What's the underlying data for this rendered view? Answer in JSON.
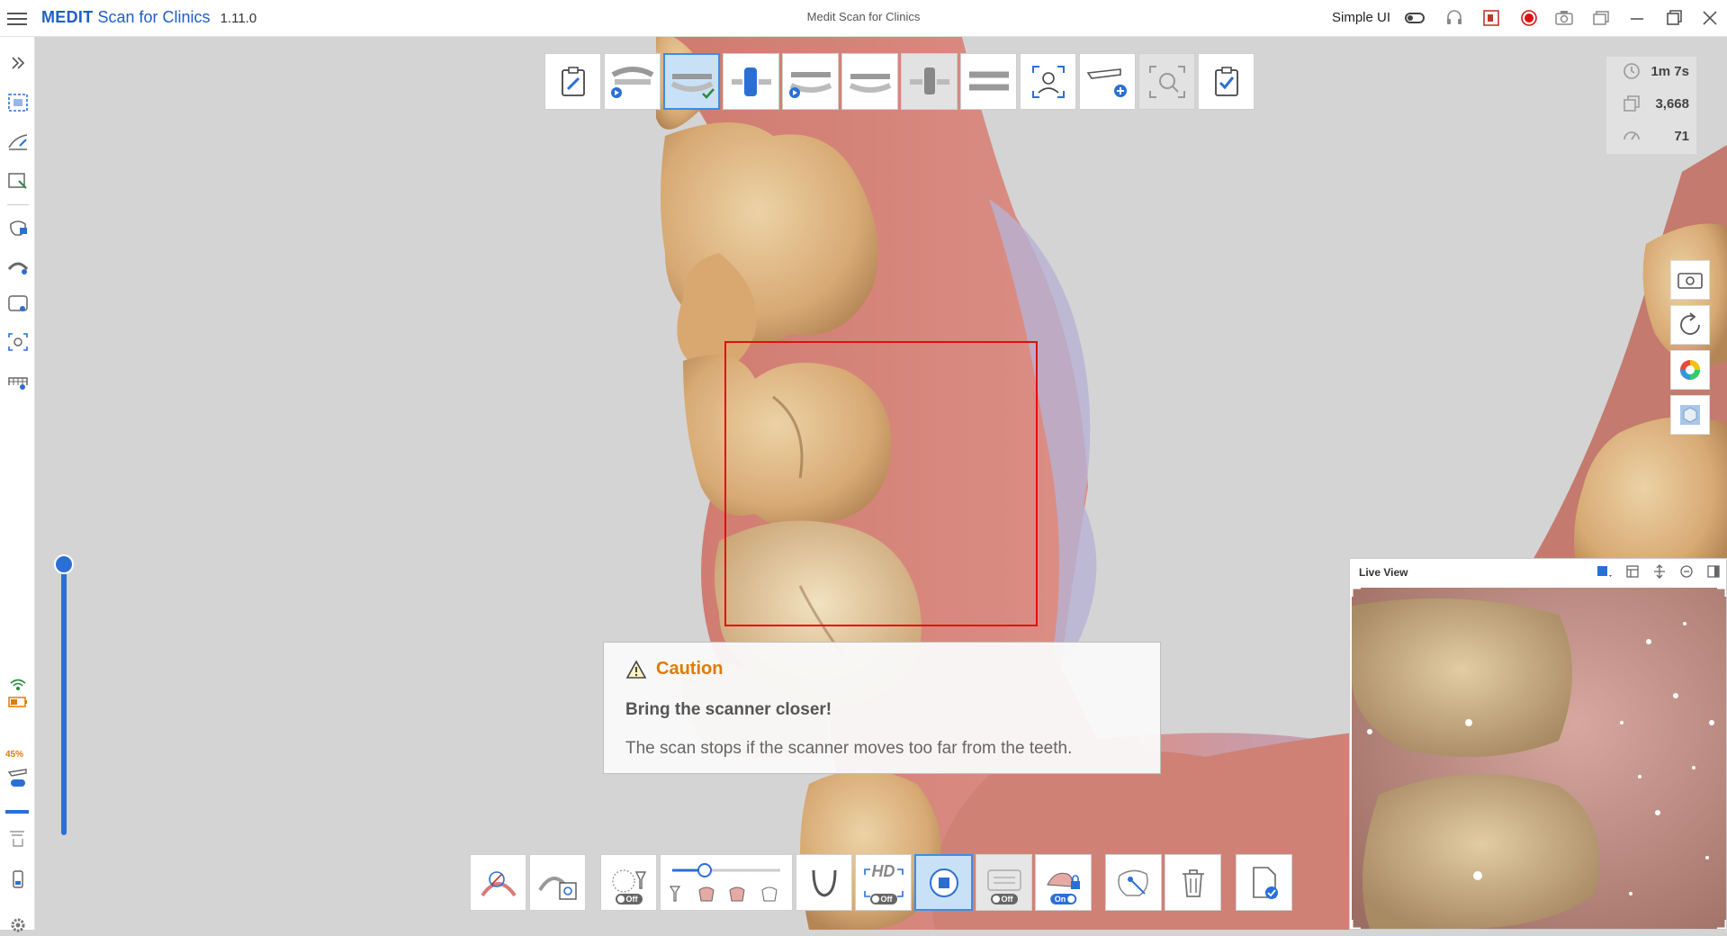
{
  "app": {
    "brand_bold": "MEDIT",
    "brand_rest": "Scan for Clinics",
    "version": "1.11.0",
    "window_title": "Medit Scan for Clinics"
  },
  "titlebar": {
    "simple_ui_label": "Simple UI",
    "simple_ui_enabled": false,
    "icons": [
      "headset-icon",
      "screen-capture-icon",
      "record-icon",
      "camera-icon",
      "window-switch-icon",
      "minimize-icon",
      "maximize-icon",
      "close-icon"
    ]
  },
  "sidebar": {
    "items": [
      "expand-icon",
      "scan-area-icon",
      "edit-scan-icon",
      "smart-select-icon",
      "lock-tooth-icon",
      "arch-icon",
      "tooth-view-icon",
      "screen-capture-icon",
      "tooth-library-icon"
    ],
    "status": {
      "wifi": "connected",
      "battery_percent": "45%",
      "scanner_mode": "active"
    }
  },
  "steps": {
    "items": [
      {
        "name": "form-step",
        "state": "normal"
      },
      {
        "name": "maxilla-step",
        "state": "normal"
      },
      {
        "name": "mandible-step",
        "state": "active"
      },
      {
        "name": "mandible-scanbody-step",
        "state": "normal"
      },
      {
        "name": "occlusion-step",
        "state": "normal"
      },
      {
        "name": "occlusion-2-step",
        "state": "normal"
      },
      {
        "name": "scanbody-step",
        "state": "dim"
      },
      {
        "name": "bite-step",
        "state": "normal"
      },
      {
        "name": "face-scan-step",
        "state": "normal"
      },
      {
        "name": "add-stage-step",
        "state": "normal"
      },
      {
        "name": "analysis-step",
        "state": "dim"
      },
      {
        "name": "complete-step",
        "state": "normal"
      }
    ]
  },
  "stats": {
    "time": "1m 7s",
    "shots": "3,668",
    "rate": "71"
  },
  "right_tools": [
    "video-camera-icon",
    "reset-view-icon",
    "color-wheel-icon",
    "cube-view-icon"
  ],
  "caution": {
    "title": "Caution",
    "message_bold": "Bring the scanner closer!",
    "message": "The scan stops if the scanner moves too far from the teeth."
  },
  "live_view": {
    "title": "Live View"
  },
  "bottom_toolbar": {
    "filter_off": "Off",
    "hd_label": "HD",
    "hd_off": "Off",
    "gingiva_off": "Off",
    "lock_on": "On",
    "filter_level": 0.3
  },
  "colors": {
    "accent": "#2b6fd6",
    "caution": "#e07b00",
    "scan_box": "#e01010"
  }
}
